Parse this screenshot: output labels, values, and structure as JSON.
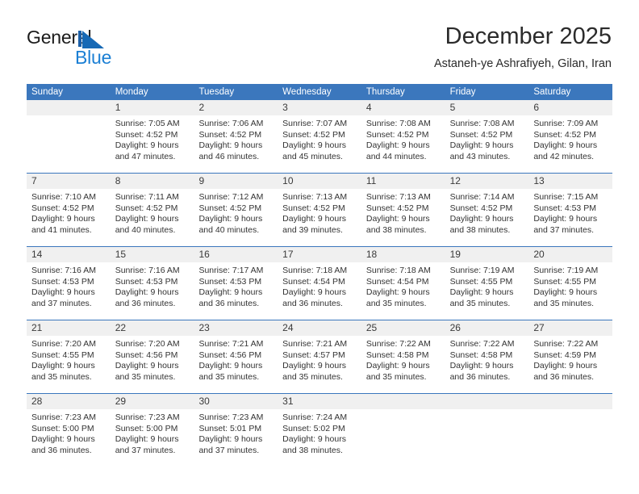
{
  "brand": {
    "name_top": "General",
    "name_bottom": "Blue",
    "triangle_icon": "blue-triangle-icon",
    "accent_color": "#1b7fd4",
    "text_color": "#1b1b1b"
  },
  "header": {
    "title": "December 2025",
    "subtitle": "Astaneh-ye Ashrafiyeh, Gilan, Iran"
  },
  "theme": {
    "header_blue": "#3b77bd",
    "daynum_band": "#f0f0f0",
    "cell_text": "#333333"
  },
  "weekdays": [
    "Sunday",
    "Monday",
    "Tuesday",
    "Wednesday",
    "Thursday",
    "Friday",
    "Saturday"
  ],
  "weeks": [
    [
      {
        "day": "",
        "lines": []
      },
      {
        "day": "1",
        "lines": [
          "Sunrise: 7:05 AM",
          "Sunset: 4:52 PM",
          "Daylight: 9 hours",
          "and 47 minutes."
        ]
      },
      {
        "day": "2",
        "lines": [
          "Sunrise: 7:06 AM",
          "Sunset: 4:52 PM",
          "Daylight: 9 hours",
          "and 46 minutes."
        ]
      },
      {
        "day": "3",
        "lines": [
          "Sunrise: 7:07 AM",
          "Sunset: 4:52 PM",
          "Daylight: 9 hours",
          "and 45 minutes."
        ]
      },
      {
        "day": "4",
        "lines": [
          "Sunrise: 7:08 AM",
          "Sunset: 4:52 PM",
          "Daylight: 9 hours",
          "and 44 minutes."
        ]
      },
      {
        "day": "5",
        "lines": [
          "Sunrise: 7:08 AM",
          "Sunset: 4:52 PM",
          "Daylight: 9 hours",
          "and 43 minutes."
        ]
      },
      {
        "day": "6",
        "lines": [
          "Sunrise: 7:09 AM",
          "Sunset: 4:52 PM",
          "Daylight: 9 hours",
          "and 42 minutes."
        ]
      }
    ],
    [
      {
        "day": "7",
        "lines": [
          "Sunrise: 7:10 AM",
          "Sunset: 4:52 PM",
          "Daylight: 9 hours",
          "and 41 minutes."
        ]
      },
      {
        "day": "8",
        "lines": [
          "Sunrise: 7:11 AM",
          "Sunset: 4:52 PM",
          "Daylight: 9 hours",
          "and 40 minutes."
        ]
      },
      {
        "day": "9",
        "lines": [
          "Sunrise: 7:12 AM",
          "Sunset: 4:52 PM",
          "Daylight: 9 hours",
          "and 40 minutes."
        ]
      },
      {
        "day": "10",
        "lines": [
          "Sunrise: 7:13 AM",
          "Sunset: 4:52 PM",
          "Daylight: 9 hours",
          "and 39 minutes."
        ]
      },
      {
        "day": "11",
        "lines": [
          "Sunrise: 7:13 AM",
          "Sunset: 4:52 PM",
          "Daylight: 9 hours",
          "and 38 minutes."
        ]
      },
      {
        "day": "12",
        "lines": [
          "Sunrise: 7:14 AM",
          "Sunset: 4:52 PM",
          "Daylight: 9 hours",
          "and 38 minutes."
        ]
      },
      {
        "day": "13",
        "lines": [
          "Sunrise: 7:15 AM",
          "Sunset: 4:53 PM",
          "Daylight: 9 hours",
          "and 37 minutes."
        ]
      }
    ],
    [
      {
        "day": "14",
        "lines": [
          "Sunrise: 7:16 AM",
          "Sunset: 4:53 PM",
          "Daylight: 9 hours",
          "and 37 minutes."
        ]
      },
      {
        "day": "15",
        "lines": [
          "Sunrise: 7:16 AM",
          "Sunset: 4:53 PM",
          "Daylight: 9 hours",
          "and 36 minutes."
        ]
      },
      {
        "day": "16",
        "lines": [
          "Sunrise: 7:17 AM",
          "Sunset: 4:53 PM",
          "Daylight: 9 hours",
          "and 36 minutes."
        ]
      },
      {
        "day": "17",
        "lines": [
          "Sunrise: 7:18 AM",
          "Sunset: 4:54 PM",
          "Daylight: 9 hours",
          "and 36 minutes."
        ]
      },
      {
        "day": "18",
        "lines": [
          "Sunrise: 7:18 AM",
          "Sunset: 4:54 PM",
          "Daylight: 9 hours",
          "and 35 minutes."
        ]
      },
      {
        "day": "19",
        "lines": [
          "Sunrise: 7:19 AM",
          "Sunset: 4:55 PM",
          "Daylight: 9 hours",
          "and 35 minutes."
        ]
      },
      {
        "day": "20",
        "lines": [
          "Sunrise: 7:19 AM",
          "Sunset: 4:55 PM",
          "Daylight: 9 hours",
          "and 35 minutes."
        ]
      }
    ],
    [
      {
        "day": "21",
        "lines": [
          "Sunrise: 7:20 AM",
          "Sunset: 4:55 PM",
          "Daylight: 9 hours",
          "and 35 minutes."
        ]
      },
      {
        "day": "22",
        "lines": [
          "Sunrise: 7:20 AM",
          "Sunset: 4:56 PM",
          "Daylight: 9 hours",
          "and 35 minutes."
        ]
      },
      {
        "day": "23",
        "lines": [
          "Sunrise: 7:21 AM",
          "Sunset: 4:56 PM",
          "Daylight: 9 hours",
          "and 35 minutes."
        ]
      },
      {
        "day": "24",
        "lines": [
          "Sunrise: 7:21 AM",
          "Sunset: 4:57 PM",
          "Daylight: 9 hours",
          "and 35 minutes."
        ]
      },
      {
        "day": "25",
        "lines": [
          "Sunrise: 7:22 AM",
          "Sunset: 4:58 PM",
          "Daylight: 9 hours",
          "and 35 minutes."
        ]
      },
      {
        "day": "26",
        "lines": [
          "Sunrise: 7:22 AM",
          "Sunset: 4:58 PM",
          "Daylight: 9 hours",
          "and 36 minutes."
        ]
      },
      {
        "day": "27",
        "lines": [
          "Sunrise: 7:22 AM",
          "Sunset: 4:59 PM",
          "Daylight: 9 hours",
          "and 36 minutes."
        ]
      }
    ],
    [
      {
        "day": "28",
        "lines": [
          "Sunrise: 7:23 AM",
          "Sunset: 5:00 PM",
          "Daylight: 9 hours",
          "and 36 minutes."
        ]
      },
      {
        "day": "29",
        "lines": [
          "Sunrise: 7:23 AM",
          "Sunset: 5:00 PM",
          "Daylight: 9 hours",
          "and 37 minutes."
        ]
      },
      {
        "day": "30",
        "lines": [
          "Sunrise: 7:23 AM",
          "Sunset: 5:01 PM",
          "Daylight: 9 hours",
          "and 37 minutes."
        ]
      },
      {
        "day": "31",
        "lines": [
          "Sunrise: 7:24 AM",
          "Sunset: 5:02 PM",
          "Daylight: 9 hours",
          "and 38 minutes."
        ]
      },
      {
        "day": "",
        "lines": []
      },
      {
        "day": "",
        "lines": []
      },
      {
        "day": "",
        "lines": []
      }
    ]
  ]
}
